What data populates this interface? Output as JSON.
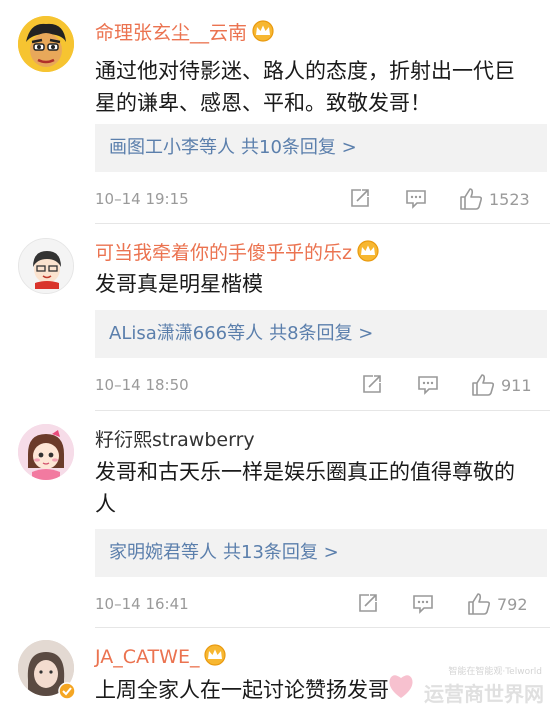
{
  "comments": [
    {
      "username": "命理张玄尘__云南",
      "vip": true,
      "text": "通过他对待影迷、路人的态度，折射出一代巨星的谦卑、感恩、平和。致敬发哥！",
      "reply_users": "画图工小李等人",
      "reply_count": "共10条回复 >",
      "time": "10–14 19:15",
      "likes": "1523"
    },
    {
      "username": "可当我牵着你的手傻乎乎的乐z",
      "vip": true,
      "text": "发哥真是明星楷模",
      "reply_users": "ALisa潇潇666等人",
      "reply_count": "共8条回复 >",
      "time": "10–14 18:50",
      "likes": "911"
    },
    {
      "username": "籽衍熙strawberry",
      "vip": false,
      "text": "发哥和古天乐一样是娱乐圈真正的值得尊敬的人",
      "reply_users": "家明婉君等人",
      "reply_count": "共13条回复 >",
      "time": "10–14 16:41",
      "likes": "792"
    },
    {
      "username": "JA_CATWE_",
      "vip": true,
      "text": "上周全家人在一起讨论赞扬发哥"
    }
  ],
  "watermark": {
    "small": "智能在智能观·Telworld",
    "big": "运营商世界网"
  },
  "colors": {
    "vip_name": "#eb7350",
    "reply_link": "#5b7fac",
    "meta": "#9a9a9a"
  }
}
